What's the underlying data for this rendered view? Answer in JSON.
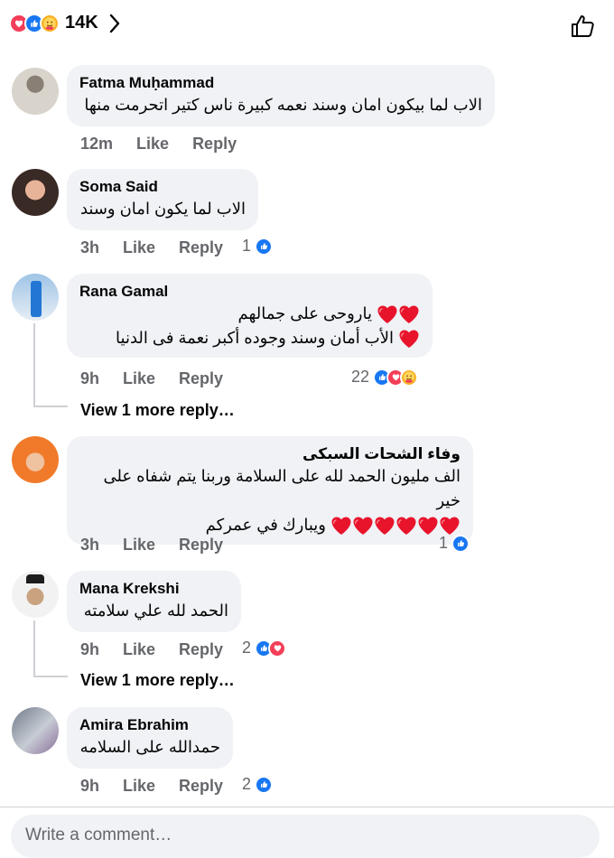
{
  "header": {
    "reaction_count": "14K"
  },
  "comments": [
    {
      "name": "Fatma Muḥammad",
      "lines": [
        "الاب لما بيكون امان وسند نعمه كبيرة ناس كتير اتحرمت منها"
      ],
      "time": "12m",
      "like": "Like",
      "reply": "Reply"
    },
    {
      "name": "Soma Said",
      "lines": [
        "الاب لما يكون امان وسند"
      ],
      "time": "3h",
      "like": "Like",
      "reply": "Reply",
      "reactions": "1"
    },
    {
      "name": "Rana Gamal",
      "lines": [
        "ياروحى على جمالهم",
        "الأب أمان وسند  وجوده أكبر نعمة فى الدنيا"
      ],
      "time": "9h",
      "like": "Like",
      "reply": "Reply",
      "reactions": "22",
      "more": "View 1 more reply…"
    },
    {
      "name": "وفاء الشحات السبكى",
      "lines": [
        "الف مليون الحمد لله على السلامة وربنا يتم شفاه على خير",
        "ويبارك في عمركم"
      ],
      "time": "3h",
      "like": "Like",
      "reply": "Reply",
      "reactions": "1"
    },
    {
      "name": "Mana Krekshi",
      "lines": [
        "الحمد لله علي سلامته"
      ],
      "time": "9h",
      "like": "Like",
      "reply": "Reply",
      "reactions": "2",
      "more": "View 1 more reply…"
    },
    {
      "name": "Amira Ebrahim",
      "lines": [
        "حمدالله على السلامه"
      ],
      "time": "9h",
      "like": "Like",
      "reply": "Reply",
      "reactions": "2"
    }
  ],
  "composer": {
    "placeholder": "Write a comment…"
  },
  "colors": {
    "like": "#1877f2",
    "love": "#f33e58",
    "care": "#f7b125",
    "bubble": "#f0f2f5",
    "meta": "#65676b"
  },
  "icons": [
    "like-icon",
    "love-icon",
    "care-icon",
    "chevron-right-icon",
    "thumbs-up-outline-icon",
    "red-heart-icon"
  ]
}
